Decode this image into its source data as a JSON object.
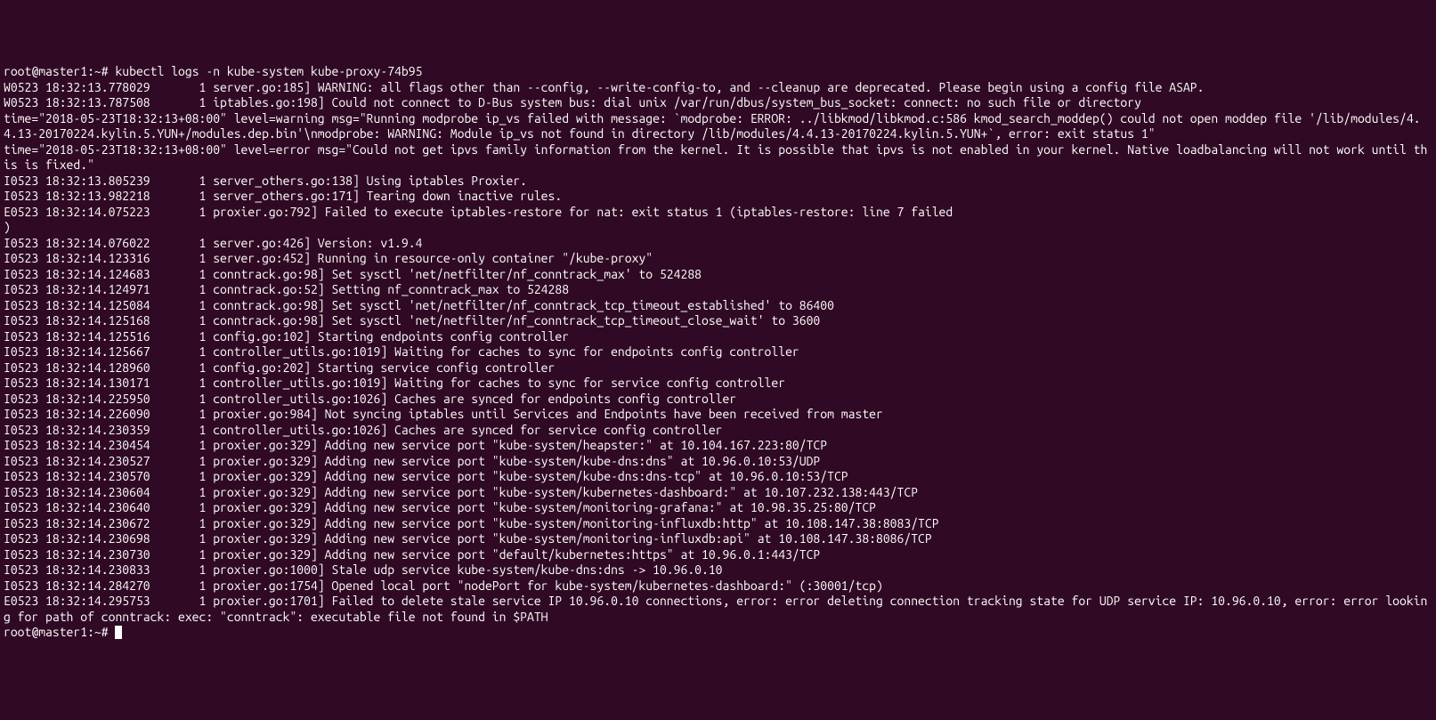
{
  "prompt1_user_host": "root@master1",
  "prompt1_path": ":~# ",
  "command": "kubectl logs -n kube-system kube-proxy-74b95",
  "lines": [
    "W0523 18:32:13.778029       1 server.go:185] WARNING: all flags other than --config, --write-config-to, and --cleanup are deprecated. Please begin using a config file ASAP.",
    "W0523 18:32:13.787508       1 iptables.go:198] Could not connect to D-Bus system bus: dial unix /var/run/dbus/system_bus_socket: connect: no such file or directory",
    "time=\"2018-05-23T18:32:13+08:00\" level=warning msg=\"Running modprobe ip_vs failed with message: `modprobe: ERROR: ../libkmod/libkmod.c:586 kmod_search_moddep() could not open moddep file '/lib/modules/4.4.13-20170224.kylin.5.YUN+/modules.dep.bin'\\nmodprobe: WARNING: Module ip_vs not found in directory /lib/modules/4.4.13-20170224.kylin.5.YUN+`, error: exit status 1\"",
    "time=\"2018-05-23T18:32:13+08:00\" level=error msg=\"Could not get ipvs family information from the kernel. It is possible that ipvs is not enabled in your kernel. Native loadbalancing will not work until this is fixed.\"",
    "I0523 18:32:13.805239       1 server_others.go:138] Using iptables Proxier.",
    "I0523 18:32:13.982218       1 server_others.go:171] Tearing down inactive rules.",
    "E0523 18:32:14.075223       1 proxier.go:792] Failed to execute iptables-restore for nat: exit status 1 (iptables-restore: line 7 failed",
    ")",
    "I0523 18:32:14.076022       1 server.go:426] Version: v1.9.4",
    "I0523 18:32:14.123316       1 server.go:452] Running in resource-only container \"/kube-proxy\"",
    "I0523 18:32:14.124683       1 conntrack.go:98] Set sysctl 'net/netfilter/nf_conntrack_max' to 524288",
    "I0523 18:32:14.124971       1 conntrack.go:52] Setting nf_conntrack_max to 524288",
    "I0523 18:32:14.125084       1 conntrack.go:98] Set sysctl 'net/netfilter/nf_conntrack_tcp_timeout_established' to 86400",
    "I0523 18:32:14.125168       1 conntrack.go:98] Set sysctl 'net/netfilter/nf_conntrack_tcp_timeout_close_wait' to 3600",
    "I0523 18:32:14.125516       1 config.go:102] Starting endpoints config controller",
    "I0523 18:32:14.125667       1 controller_utils.go:1019] Waiting for caches to sync for endpoints config controller",
    "I0523 18:32:14.128960       1 config.go:202] Starting service config controller",
    "I0523 18:32:14.130171       1 controller_utils.go:1019] Waiting for caches to sync for service config controller",
    "I0523 18:32:14.225950       1 controller_utils.go:1026] Caches are synced for endpoints config controller",
    "I0523 18:32:14.226090       1 proxier.go:984] Not syncing iptables until Services and Endpoints have been received from master",
    "I0523 18:32:14.230359       1 controller_utils.go:1026] Caches are synced for service config controller",
    "I0523 18:32:14.230454       1 proxier.go:329] Adding new service port \"kube-system/heapster:\" at 10.104.167.223:80/TCP",
    "I0523 18:32:14.230527       1 proxier.go:329] Adding new service port \"kube-system/kube-dns:dns\" at 10.96.0.10:53/UDP",
    "I0523 18:32:14.230570       1 proxier.go:329] Adding new service port \"kube-system/kube-dns:dns-tcp\" at 10.96.0.10:53/TCP",
    "I0523 18:32:14.230604       1 proxier.go:329] Adding new service port \"kube-system/kubernetes-dashboard:\" at 10.107.232.138:443/TCP",
    "I0523 18:32:14.230640       1 proxier.go:329] Adding new service port \"kube-system/monitoring-grafana:\" at 10.98.35.25:80/TCP",
    "I0523 18:32:14.230672       1 proxier.go:329] Adding new service port \"kube-system/monitoring-influxdb:http\" at 10.108.147.38:8083/TCP",
    "I0523 18:32:14.230698       1 proxier.go:329] Adding new service port \"kube-system/monitoring-influxdb:api\" at 10.108.147.38:8086/TCP",
    "I0523 18:32:14.230730       1 proxier.go:329] Adding new service port \"default/kubernetes:https\" at 10.96.0.1:443/TCP",
    "I0523 18:32:14.230833       1 proxier.go:1000] Stale udp service kube-system/kube-dns:dns -> 10.96.0.10",
    "I0523 18:32:14.284270       1 proxier.go:1754] Opened local port \"nodePort for kube-system/kubernetes-dashboard:\" (:30001/tcp)",
    "E0523 18:32:14.295753       1 proxier.go:1701] Failed to delete stale service IP 10.96.0.10 connections, error: error deleting connection tracking state for UDP service IP: 10.96.0.10, error: error looking for path of conntrack: exec: \"conntrack\": executable file not found in $PATH"
  ],
  "prompt2_user_host": "root@master1",
  "prompt2_path": ":~# "
}
